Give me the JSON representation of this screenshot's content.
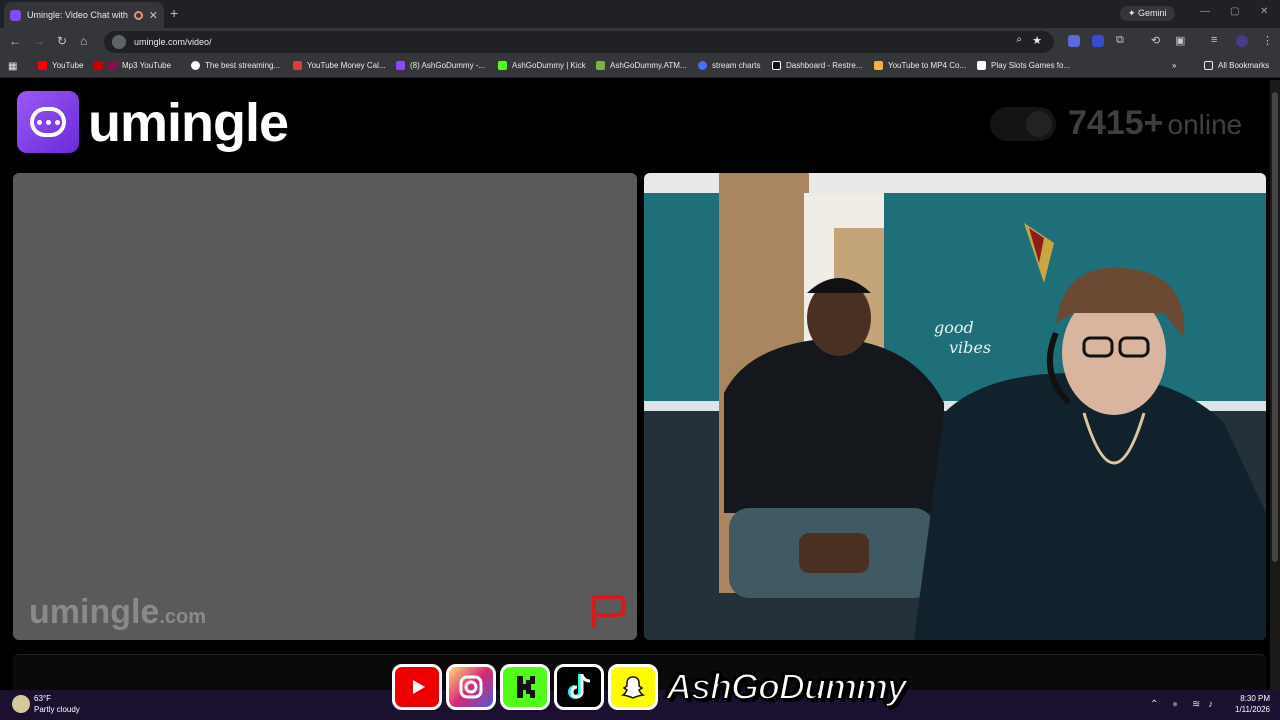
{
  "browser": {
    "tab_title": "Umingle: Video Chat with S",
    "tab_close": "✕",
    "new_tab": "+",
    "gemini_label": "Gemini",
    "url": "umingle.com/video/",
    "bookmarks": [
      {
        "label": "YouTube",
        "color": "#ff0000"
      },
      {
        "label": "Mp3 YouTube",
        "color": "#cc0000"
      },
      {
        "label": "The best streaming...",
        "color": "#ffffff"
      },
      {
        "label": "YouTube Money Cal...",
        "color": "#e53935"
      },
      {
        "label": "(8) AshGoDummy -...",
        "color": "#9146ff"
      },
      {
        "label": "AshGoDummy | Kick",
        "color": "#53fc18"
      },
      {
        "label": "AshGoDummy.ATM...",
        "color": "#7cb342"
      },
      {
        "label": "stream charts",
        "color": "#4a6cf7"
      },
      {
        "label": "Dashboard - Restre...",
        "color": "#111111"
      },
      {
        "label": "YouTube to MP4 Co...",
        "color": "#f5b041"
      },
      {
        "label": "Play Slots Games fo...",
        "color": "#ffffff"
      }
    ],
    "all_bookmarks": "All Bookmarks"
  },
  "site": {
    "brand": "umingle",
    "online_count": "7415+",
    "online_label": "online",
    "watermark_main": "umingle",
    "watermark_suffix": ".com",
    "accent": "#7b3fe4"
  },
  "overlay": {
    "handle": "AshGoDummy",
    "icons": [
      "youtube-icon",
      "instagram-icon",
      "kick-icon",
      "tiktok-icon",
      "snapchat-icon"
    ]
  },
  "taskbar": {
    "temp": "63°F",
    "condition": "Partly cloudy",
    "time": "8:30 PM",
    "date": "1/11/2026"
  }
}
